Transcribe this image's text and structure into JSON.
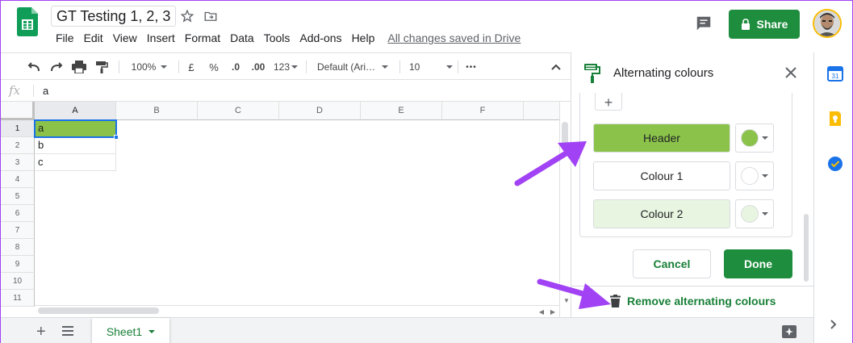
{
  "doc": {
    "title": "GT Testing 1, 2, 3",
    "save_status": "All changes saved in Drive",
    "share_label": "Share"
  },
  "menu": [
    "File",
    "Edit",
    "View",
    "Insert",
    "Format",
    "Data",
    "Tools",
    "Add-ons",
    "Help"
  ],
  "toolbar": {
    "zoom": "100%",
    "currency": "£",
    "percent": "%",
    "dec_decrease": ".0",
    "dec_increase": ".00",
    "more_formats": "123",
    "font": "Default (Ari…",
    "font_size": "10",
    "more": "•••"
  },
  "formula_bar": {
    "fx": "fx",
    "value": "a"
  },
  "grid": {
    "columns": [
      "A",
      "B",
      "C",
      "D",
      "E",
      "F"
    ],
    "rows": [
      "1",
      "2",
      "3",
      "4",
      "5",
      "6",
      "7",
      "8",
      "9",
      "10",
      "11"
    ],
    "cells": {
      "a1": "a",
      "a2": "b",
      "a3": "c"
    }
  },
  "sheet": {
    "tab_name": "Sheet1"
  },
  "panel": {
    "title": "Alternating colours",
    "add_style": "+",
    "rows": [
      {
        "label": "Header",
        "fill": "#8bc34a",
        "swatch": "#8bc34a"
      },
      {
        "label": "Colour 1",
        "fill": "#ffffff",
        "swatch": "#ffffff"
      },
      {
        "label": "Colour 2",
        "fill": "#e8f5e0",
        "swatch": "#e8f5e0"
      }
    ],
    "cancel_label": "Cancel",
    "done_label": "Done",
    "remove_label": "Remove alternating colours"
  },
  "colors": {
    "brand_green": "#1e8e3e",
    "link_green": "#188038",
    "selection_blue": "#1a73e8",
    "annotation_purple": "#a142f4"
  }
}
